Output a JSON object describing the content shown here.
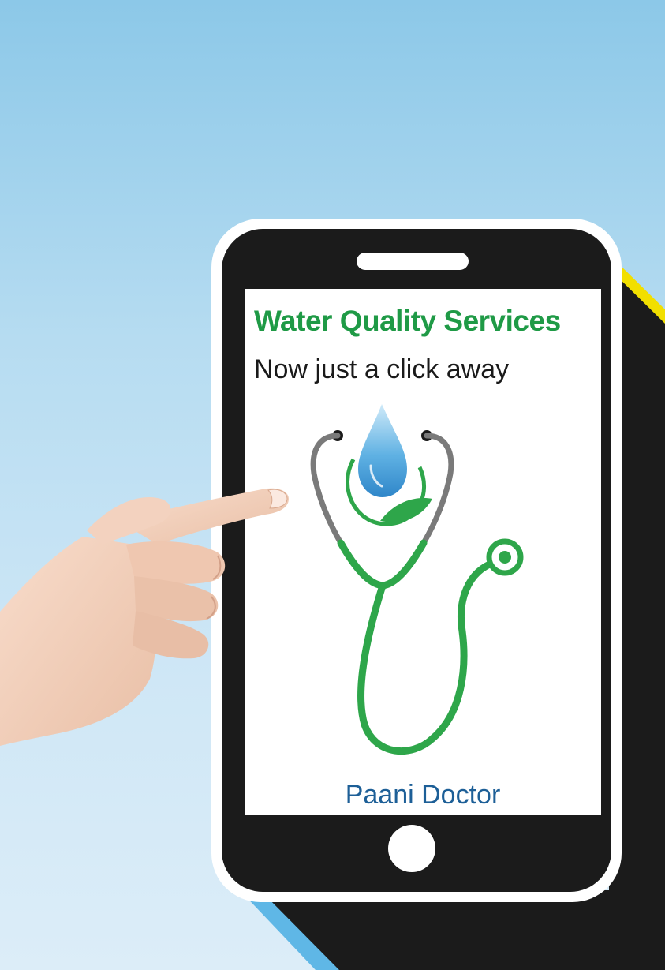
{
  "screen": {
    "title": "Water Quality Services",
    "subtitle": "Now just a click away",
    "brand": "Paani Doctor"
  },
  "colors": {
    "sky_top": "#8cc8e8",
    "sky_bottom": "#dcedf8",
    "phone_body": "#1b1b1b",
    "phone_border": "#ffffff",
    "title_green": "#1f9a46",
    "stethoscope_green": "#2ea64a",
    "brand_blue": "#1d5f97",
    "accent_yellow": "#f2df00",
    "accent_blue": "#5fb7e6",
    "drop_blue": "#5fb1e3"
  },
  "icons": {
    "logo": "water-drop-stethoscope-icon",
    "hand": "pointing-hand-icon"
  }
}
